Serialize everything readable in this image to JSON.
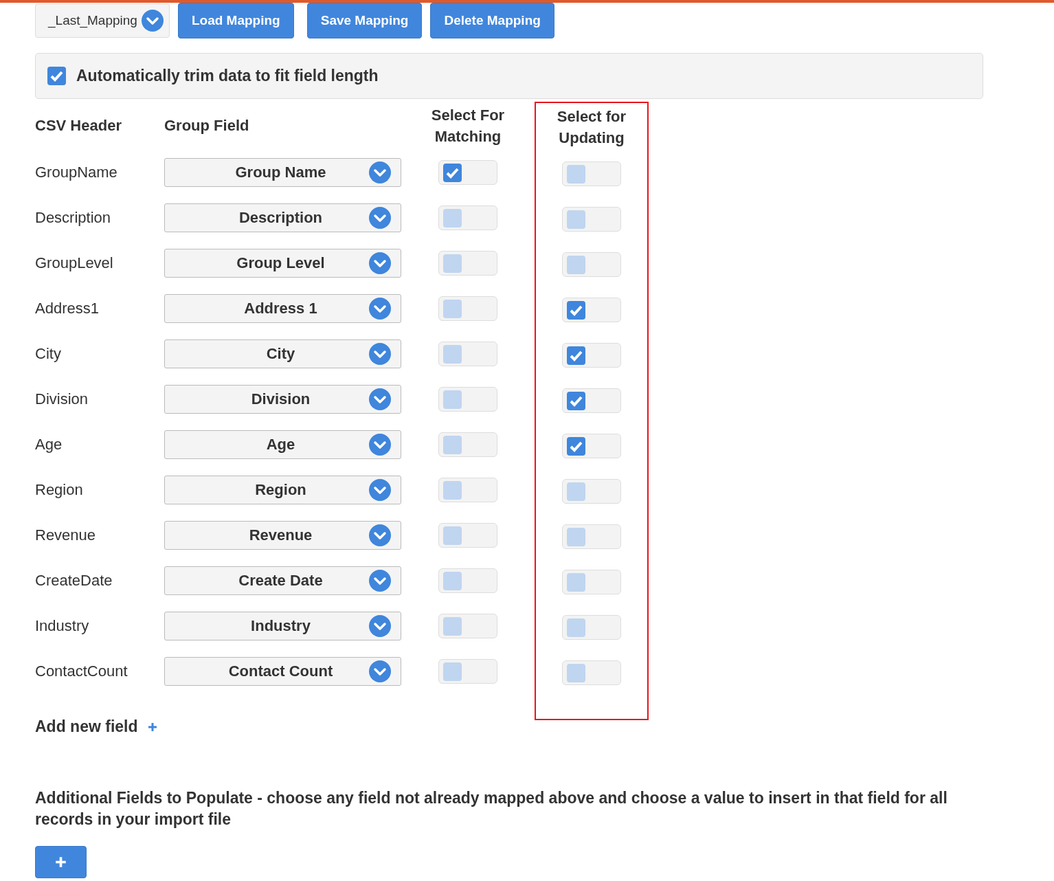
{
  "toolbar": {
    "mapping_select": {
      "value": "_Last_Mapping"
    },
    "buttons": [
      "Load Mapping",
      "Save Mapping",
      "Delete Mapping"
    ]
  },
  "trim_option": {
    "label": "Automatically trim data to fit field length",
    "checked": true
  },
  "table": {
    "columns": [
      "CSV Header",
      "Group Field",
      "Select For Matching",
      "Select for Updating"
    ],
    "rows": [
      {
        "csv_header": "GroupName",
        "group_field": "Group Name",
        "matching": true,
        "updating": false
      },
      {
        "csv_header": "Description",
        "group_field": "Description",
        "matching": false,
        "updating": false
      },
      {
        "csv_header": "GroupLevel",
        "group_field": "Group Level",
        "matching": false,
        "updating": false
      },
      {
        "csv_header": "Address1",
        "group_field": "Address 1",
        "matching": false,
        "updating": true
      },
      {
        "csv_header": "City",
        "group_field": "City",
        "matching": false,
        "updating": true
      },
      {
        "csv_header": "Division",
        "group_field": "Division",
        "matching": false,
        "updating": true
      },
      {
        "csv_header": "Age",
        "group_field": "Age",
        "matching": false,
        "updating": true
      },
      {
        "csv_header": "Region",
        "group_field": "Region",
        "matching": false,
        "updating": false
      },
      {
        "csv_header": "Revenue",
        "group_field": "Revenue",
        "matching": false,
        "updating": false
      },
      {
        "csv_header": "CreateDate",
        "group_field": "Create Date",
        "matching": false,
        "updating": false
      },
      {
        "csv_header": "Industry",
        "group_field": "Industry",
        "matching": false,
        "updating": false
      },
      {
        "csv_header": "ContactCount",
        "group_field": "Contact Count",
        "matching": false,
        "updating": false
      }
    ]
  },
  "add_field": {
    "label": "Add new field"
  },
  "additional": {
    "text": "Additional Fields to Populate - choose any field not already mapped above and choose a value to insert in that field for all records in your import file"
  }
}
